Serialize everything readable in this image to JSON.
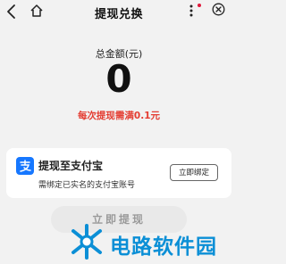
{
  "header": {
    "title": "提现兑换"
  },
  "balance": {
    "label": "总金额(元)",
    "value": "0",
    "hint": "每次提现需满0.1元"
  },
  "withdraw_method": {
    "title": "提现至支付宝",
    "subtitle": "需绑定已实名的支付宝账号",
    "bind_label": "立即绑定"
  },
  "submit_label": "立即提现",
  "watermark": {
    "text": "电路软件园"
  },
  "colors": {
    "hint_red": "#e43d32",
    "alipay_blue": "#1677ff",
    "watermark_blue": "#0b8fd6"
  },
  "icons": {
    "back": "back-icon",
    "home": "home-icon",
    "more": "more-icon",
    "close": "close-icon",
    "alipay": "alipay-icon"
  }
}
